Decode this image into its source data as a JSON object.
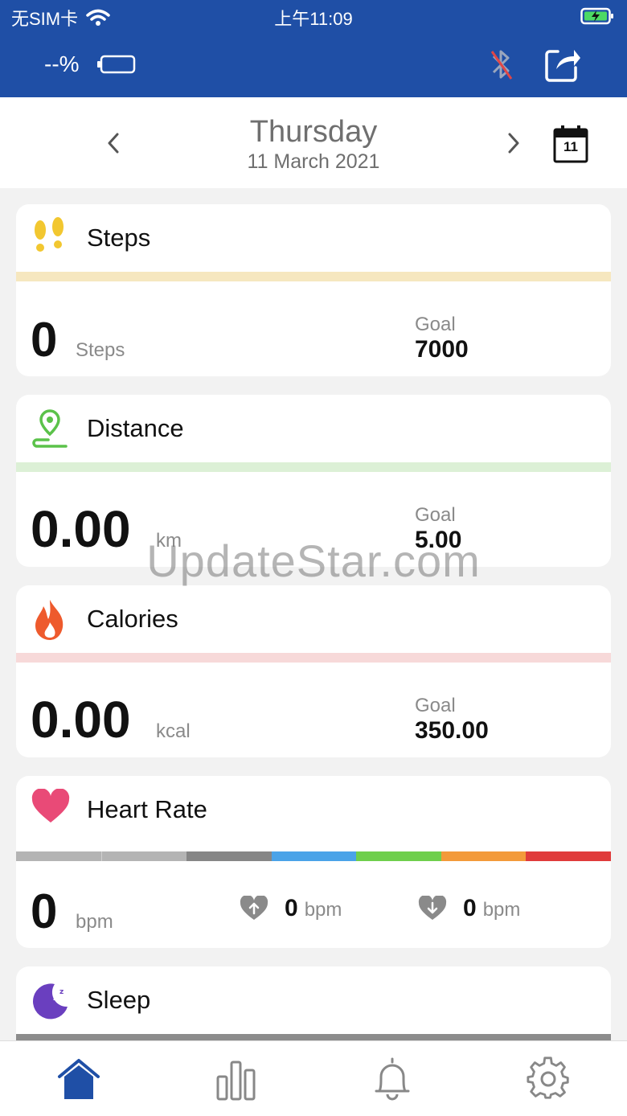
{
  "status_bar": {
    "carrier": "无SIM卡",
    "time": "上午11:09"
  },
  "header": {
    "battery_percent": "--%",
    "icons": [
      "bluetooth-off-icon",
      "share-icon"
    ]
  },
  "date_nav": {
    "day": "Thursday",
    "date": "11 March 2021",
    "calendar_day": "11"
  },
  "steps": {
    "title": "Steps",
    "value": "0",
    "unit": "Steps",
    "goal_label": "Goal",
    "goal_value": "7000",
    "accent": "#f6e7bf"
  },
  "distance": {
    "title": "Distance",
    "value": "0.00",
    "unit": "km",
    "goal_label": "Goal",
    "goal_value": "5.00",
    "accent": "#dcf0d6"
  },
  "calories": {
    "title": "Calories",
    "value": "0.00",
    "unit": "kcal",
    "goal_label": "Goal",
    "goal_value": "350.00",
    "accent": "#f7d9d9"
  },
  "heart_rate": {
    "title": "Heart Rate",
    "value": "0",
    "unit": "bpm",
    "max_value": "0",
    "max_unit": "bpm",
    "min_value": "0",
    "min_unit": "bpm",
    "zone_colors": [
      "#b4b4b4",
      "#b4b4b4",
      "#868686",
      "#4aa3e8",
      "#6fcf4c",
      "#f39a3a",
      "#e03b3b"
    ]
  },
  "sleep": {
    "title": "Sleep"
  },
  "watermark": "UpdateStar.com",
  "tabbar": {
    "icons": [
      "home-icon",
      "stats-icon",
      "bell-icon",
      "settings-icon"
    ],
    "active_color": "#1f4fa6"
  }
}
